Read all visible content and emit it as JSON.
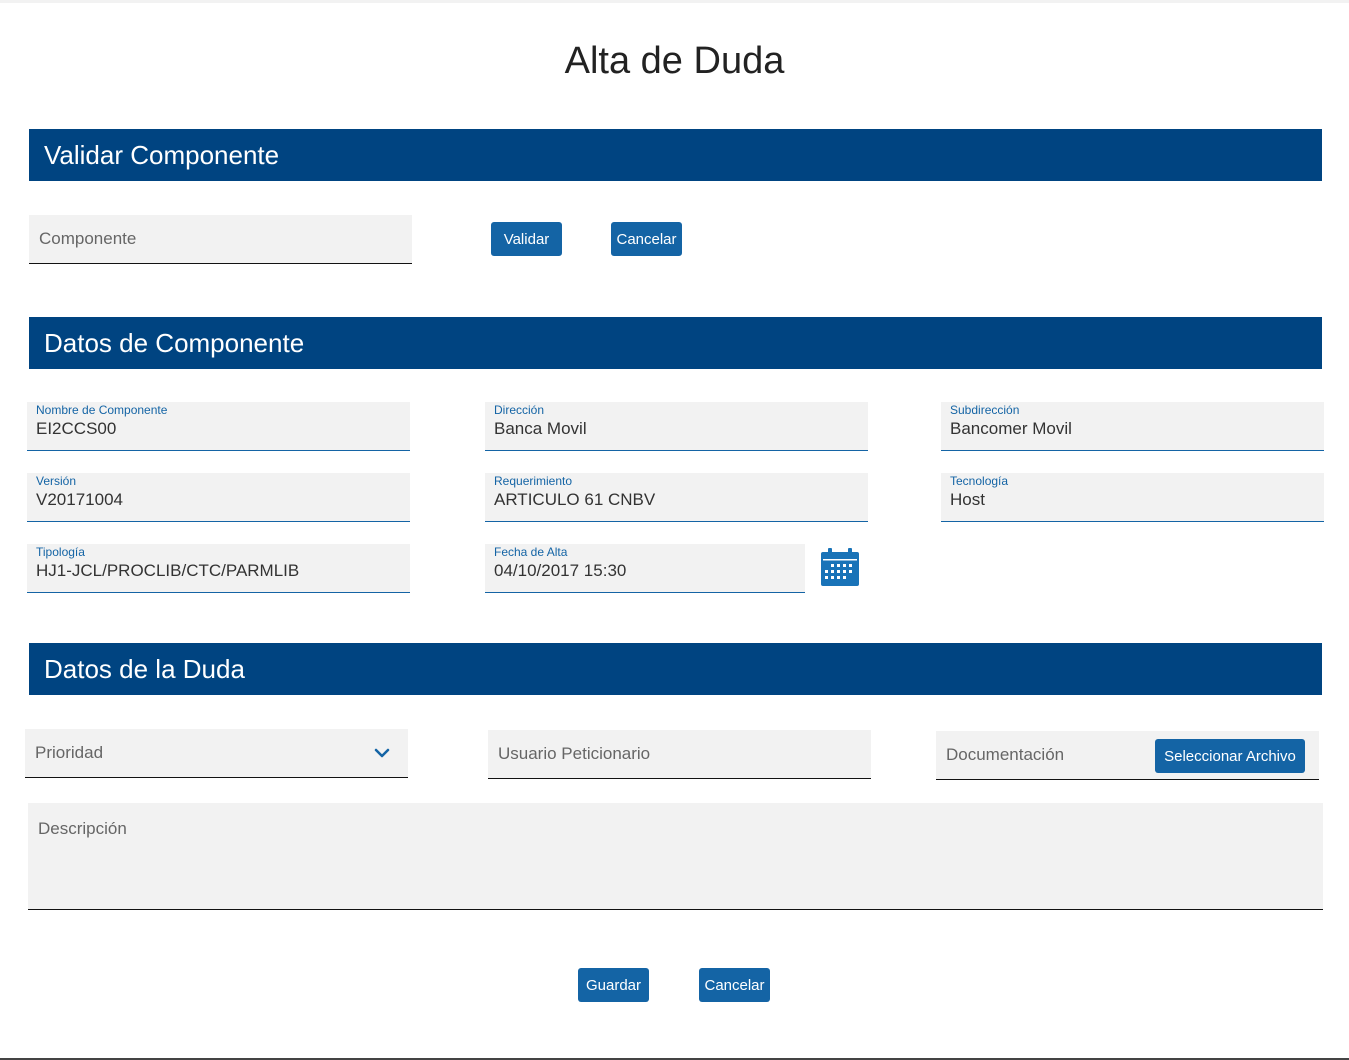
{
  "page": {
    "title": "Alta de Duda"
  },
  "validar": {
    "section_title": "Validar Componente",
    "componente_placeholder": "Componente",
    "validar_label": "Validar",
    "cancelar_label": "Cancelar"
  },
  "datos_componente": {
    "section_title": "Datos de Componente",
    "fields": [
      {
        "label": "Nombre de Componente",
        "value": "EI2CCS00"
      },
      {
        "label": "Dirección",
        "value": "Banca Movil"
      },
      {
        "label": "Subdirección",
        "value": "Bancomer Movil"
      },
      {
        "label": "Versión",
        "value": "V20171004"
      },
      {
        "label": "Requerimiento",
        "value": "ARTICULO 61 CNBV"
      },
      {
        "label": "Tecnología",
        "value": "Host"
      },
      {
        "label": "Tipología",
        "value": "HJ1-JCL/PROCLIB/CTC/PARMLIB"
      },
      {
        "label": "Fecha de Alta",
        "value": "04/10/2017 15:30"
      }
    ],
    "calendar_icon": "calendar-icon"
  },
  "datos_duda": {
    "section_title": "Datos de la Duda",
    "prioridad_placeholder": "Prioridad",
    "usuario_placeholder": "Usuario Peticionario",
    "documentacion_placeholder": "Documentación",
    "seleccionar_label": "Seleccionar Archivo",
    "descripcion_placeholder": "Descripción"
  },
  "footer": {
    "guardar_label": "Guardar",
    "cancelar_label": "Cancelar"
  },
  "colors": {
    "primary": "#004481",
    "button": "#1464a5",
    "field_bg": "#f2f2f2"
  }
}
